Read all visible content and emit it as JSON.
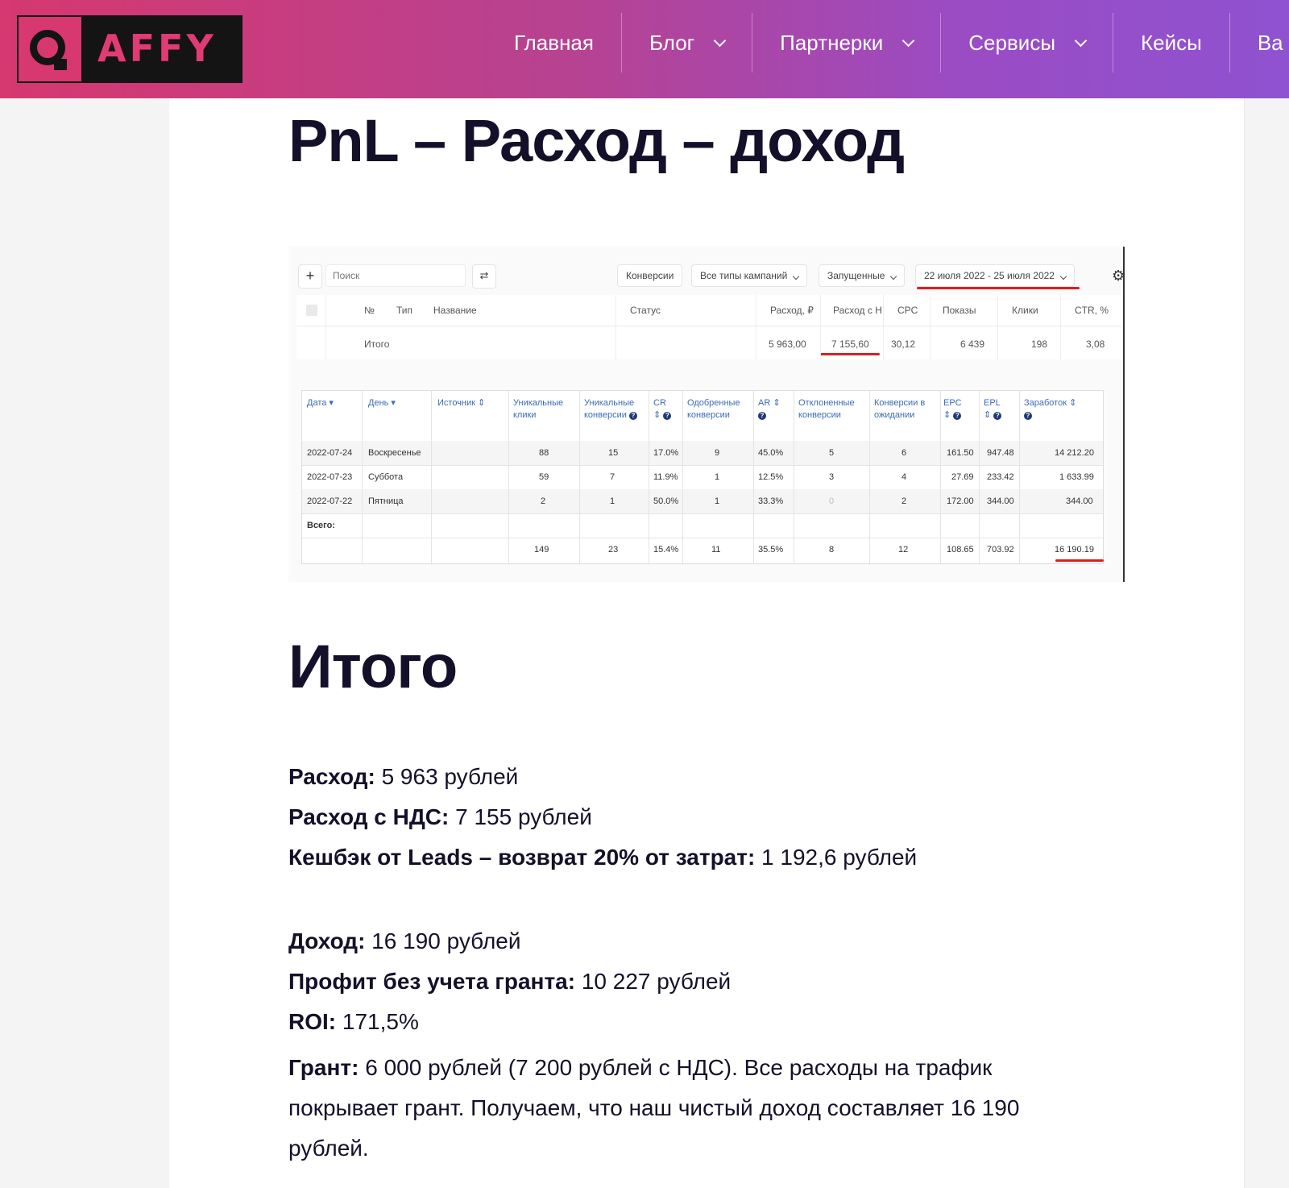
{
  "brand": {
    "logo_text": "AFFY",
    "accent": "#d6386f"
  },
  "nav": [
    {
      "label": "Главная",
      "has_dropdown": false
    },
    {
      "label": "Блог",
      "has_dropdown": true
    },
    {
      "label": "Партнерки",
      "has_dropdown": true
    },
    {
      "label": "Сервисы",
      "has_dropdown": true
    },
    {
      "label": "Кейсы",
      "has_dropdown": false
    },
    {
      "label": "Ва",
      "has_dropdown": false
    }
  ],
  "article": {
    "title": "PnL – Расход – доход",
    "section_title": "Итого",
    "lines": [
      {
        "label": "Расход:",
        "value": " 5 963 рублей"
      },
      {
        "label": "Расход с НДС:",
        "value": " 7 155 рублей"
      },
      {
        "label": "Кешбэк от Leads – возврат 20% от затрат:",
        "value": " 1 192,6 рублей"
      },
      {
        "label": "Доход:",
        "value": " 16 190 рублей"
      },
      {
        "label": "Профит без учета гранта:",
        "value": " 10 227 рублей"
      },
      {
        "label": "ROI:",
        "value": " 171,5%"
      }
    ],
    "grant": {
      "label": "Грант:",
      "value": " 6 000 рублей (7 200 рублей с НДС). Все расходы на трафик покрывает грант. Получаем, что наш чистый доход составляет 16 190 рублей."
    }
  },
  "screenshot": {
    "toolbar": {
      "plus": "+",
      "search_placeholder": "Поиск",
      "filter_icon": "⇄",
      "conversions": "Конверсии",
      "campaign_types": "Все типы кампаний",
      "status_filter": "Запущенные",
      "date_range": "22 июля 2022 - 25 июля 2022",
      "gear": "⚙"
    },
    "campaign_headers": [
      "№",
      "Тип",
      "Название",
      "Статус",
      "Расход, ₽",
      "Расход с Н",
      "CPC",
      "Показы",
      "Клики",
      "CTR, %"
    ],
    "campaign_total": {
      "label": "Итого",
      "spend": "5 963,00",
      "spend_vat": "7 155,60",
      "cpc": "30,12",
      "impressions": "6 439",
      "clicks": "198",
      "ctr": "3,08"
    },
    "stats_headers": [
      "Дата",
      "День",
      "Источник",
      "Уникальные клики",
      "Уникальные конверсии",
      "CR",
      "Одобренные конверсии",
      "AR",
      "Отклоненные конверсии",
      "Конверсии в ожидании",
      "EPC",
      "EPL",
      "Заработок"
    ],
    "stats_rows": [
      [
        "2022-07-24",
        "Воскресенье",
        "",
        "88",
        "15",
        "17.0%",
        "9",
        "45.0%",
        "5",
        "6",
        "161.50",
        "947.48",
        "14 212.20"
      ],
      [
        "2022-07-23",
        "Суббота",
        "",
        "59",
        "7",
        "11.9%",
        "1",
        "12.5%",
        "3",
        "4",
        "27.69",
        "233.42",
        "1 633.99"
      ],
      [
        "2022-07-22",
        "Пятница",
        "",
        "2",
        "1",
        "50.0%",
        "1",
        "33.3%",
        "0",
        "2",
        "172.00",
        "344.00",
        "344.00"
      ]
    ],
    "total_label": "Всего:",
    "stats_total": [
      "",
      "",
      "",
      "149",
      "23",
      "15.4%",
      "11",
      "35.5%",
      "8",
      "12",
      "108.65",
      "703.92",
      "16 190.19"
    ]
  }
}
